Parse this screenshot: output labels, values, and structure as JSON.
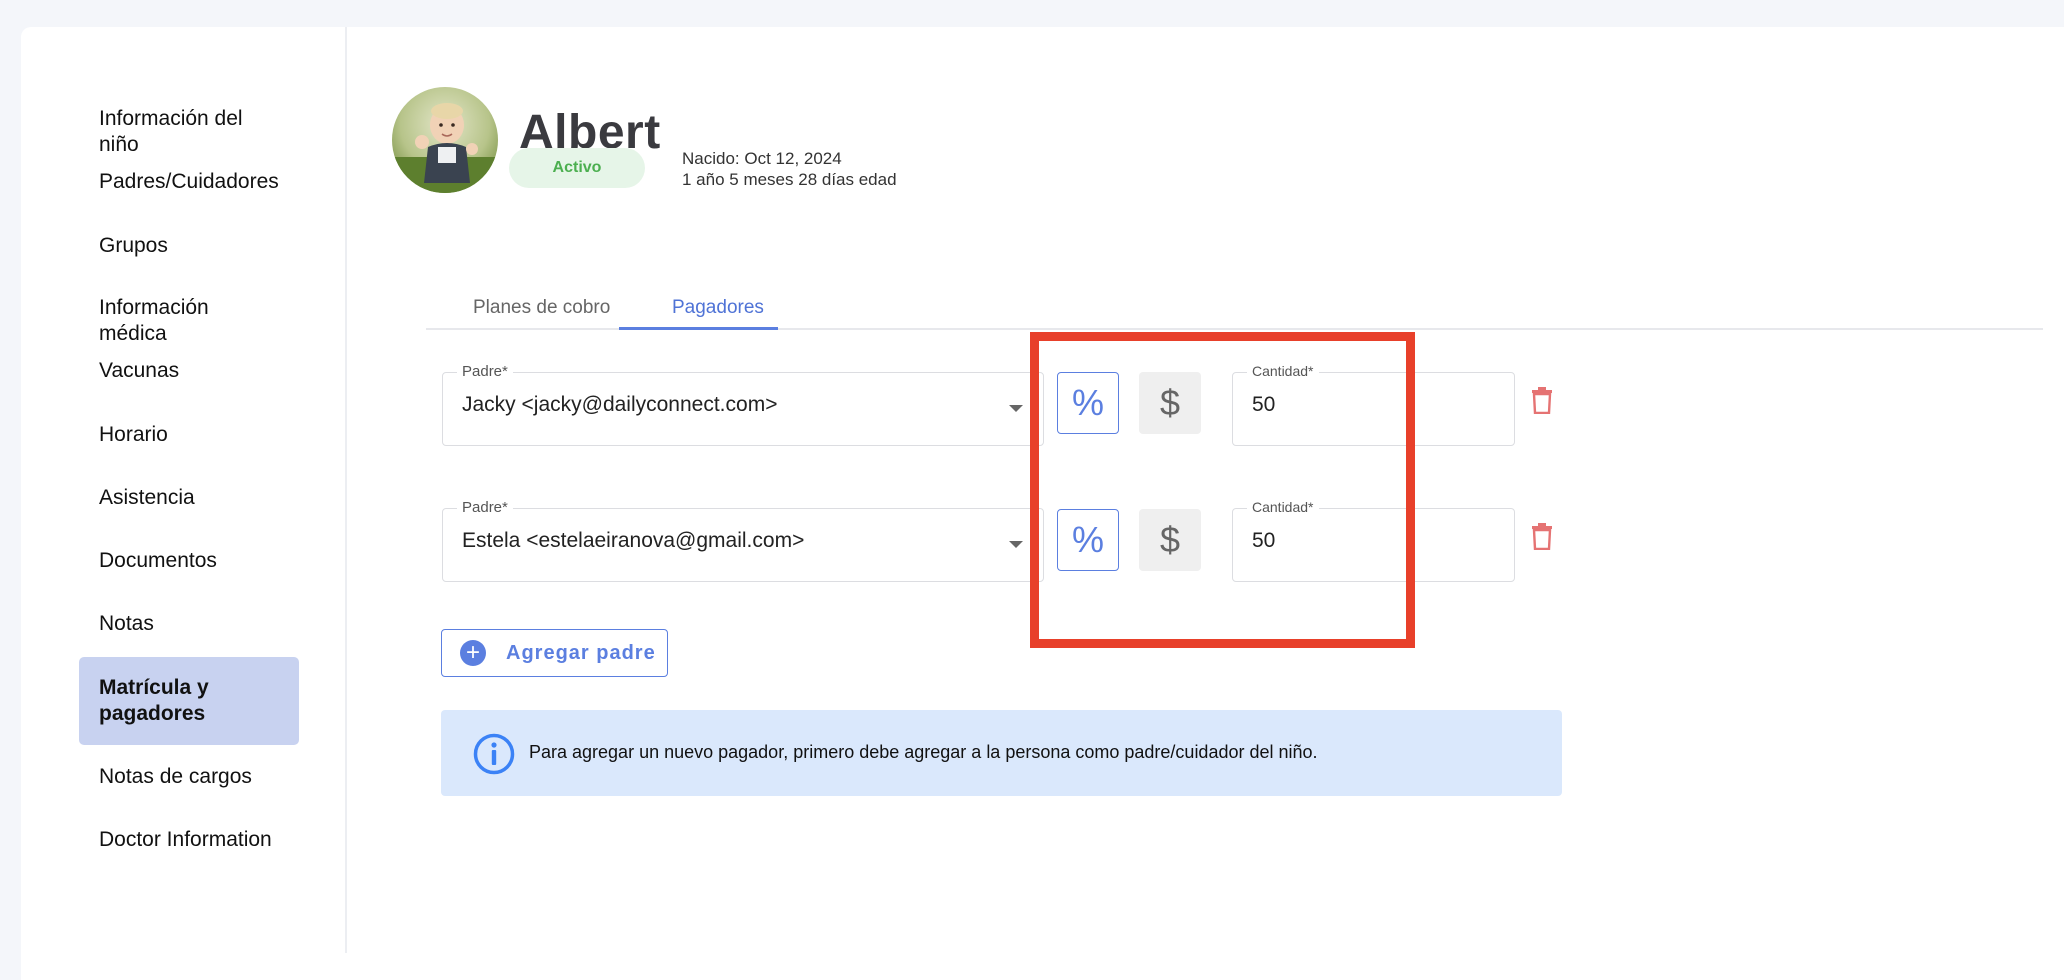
{
  "sidebar": {
    "items": [
      {
        "label": "Información del niño"
      },
      {
        "label": "Padres/Cuidadores"
      },
      {
        "label": "Grupos"
      },
      {
        "label": "Información médica"
      },
      {
        "label": "Vacunas"
      },
      {
        "label": "Horario"
      },
      {
        "label": "Asistencia"
      },
      {
        "label": "Documentos"
      },
      {
        "label": "Notas"
      },
      {
        "label": "Matrícula y pagadores",
        "active": true
      },
      {
        "label": "Notas de cargos"
      },
      {
        "label": "Doctor Information"
      }
    ]
  },
  "child": {
    "name": "Albert",
    "status": "Activo",
    "born": "Nacido: Oct 12, 2024",
    "age": "1 año 5 meses 28 días edad"
  },
  "tabs": [
    {
      "label": "Planes de cobro",
      "active": false
    },
    {
      "label": "Pagadores",
      "active": true
    }
  ],
  "payers": [
    {
      "parent_label": "Padre*",
      "parent_value": "Jacky <jacky@dailyconnect.com>",
      "pct_symbol": "%",
      "usd_symbol": "$",
      "amount_label": "Cantidad*",
      "amount": "50"
    },
    {
      "parent_label": "Padre*",
      "parent_value": "Estela <estelaeiranova@gmail.com>",
      "pct_symbol": "%",
      "usd_symbol": "$",
      "amount_label": "Cantidad*",
      "amount": "50"
    }
  ],
  "add_parent_label": "Agregar padre",
  "info_message": "Para agregar un nuevo pagador, primero debe agregar a la persona como padre/cuidador del niño.",
  "colors": {
    "accent": "#5b7fe0",
    "active_nav_bg": "#c8d2f0",
    "status_green": "#4caf50",
    "alert_bg": "#dae8fc",
    "annotation_red": "#e8402a",
    "trash_red": "#e57373"
  }
}
